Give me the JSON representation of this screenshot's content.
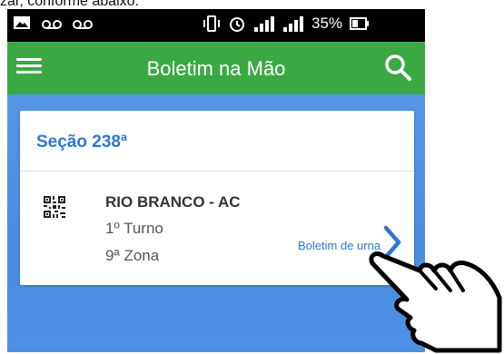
{
  "caption": "zar, conforme abaixo:",
  "status_bar": {
    "battery_percent": "35%"
  },
  "app_bar": {
    "title": "Boletim na Mão",
    "menu_icon": "hamburger-menu-icon",
    "search_icon": "search-icon"
  },
  "card": {
    "title": "Seção 238ª",
    "city": "RIO BRANCO - AC",
    "turno": "1º Turno",
    "zona": "9ª Zona",
    "link_label": "Boletim de urna",
    "qr_icon": "qr-code-icon",
    "chevron_icon": "chevron-right-icon"
  },
  "colors": {
    "app_bar": "#3aa944",
    "accent": "#2e77cf",
    "background": "#4a8ce0"
  }
}
